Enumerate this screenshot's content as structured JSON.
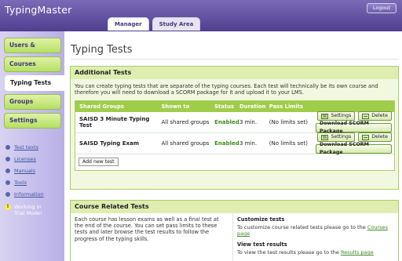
{
  "app": {
    "brand": "TypingMaster",
    "logout": "Logout"
  },
  "tabs": [
    {
      "label": "Manager"
    },
    {
      "label": "Study Area"
    }
  ],
  "sidebar": {
    "items": [
      {
        "label": "Users & Results"
      },
      {
        "label": "Courses"
      },
      {
        "label": "Typing Tests"
      },
      {
        "label": "Groups"
      },
      {
        "label": "Settings"
      }
    ],
    "links": [
      {
        "label": "Test texts"
      },
      {
        "label": "Licenses"
      },
      {
        "label": "Manuals"
      },
      {
        "label": "Tools"
      },
      {
        "label": "Information"
      }
    ],
    "trial": "Working in\nTrial Mode!"
  },
  "main": {
    "title": "Typing Tests",
    "additional": {
      "title": "Additional Tests",
      "description": "You can create typing tests that are separate of the typing courses. Each test will technically be its own course and therefore you will need to download a SCORM package for it and upload it to your LMS.",
      "headers": {
        "shared_groups": "Shared Groups",
        "shown_to": "Shown to",
        "status": "Status",
        "duration": "Duration",
        "pass_limits": "Pass Limits"
      },
      "rows": [
        {
          "name": "SAISD 3 Minute Typing Test",
          "shown_to": "All shared groups",
          "status": "Enabled",
          "duration": "3 min.",
          "pass_limits": "(No limits set)"
        },
        {
          "name": "SAISD Typing Exam",
          "shown_to": "All shared groups",
          "status": "Enabled",
          "duration": "3 min.",
          "pass_limits": "(No limits set)"
        }
      ],
      "buttons": {
        "settings": "Settings",
        "delete": "Delete",
        "download": "Download SCORM Package",
        "add_new": "Add new test"
      }
    },
    "course": {
      "title": "Course Related Tests",
      "left_text": "Each course has lesson exams as well as a final test at the end of the course. You can set pass limits to these tests and later browse the test results to follow the progress of the typing skills.",
      "customize_title": "Customize tests",
      "customize_text": "To customize course related tests please go to the",
      "customize_link": "Courses page",
      "results_title": "View test results",
      "results_text": "To view the test results please go to the",
      "results_link": "Results page"
    }
  }
}
